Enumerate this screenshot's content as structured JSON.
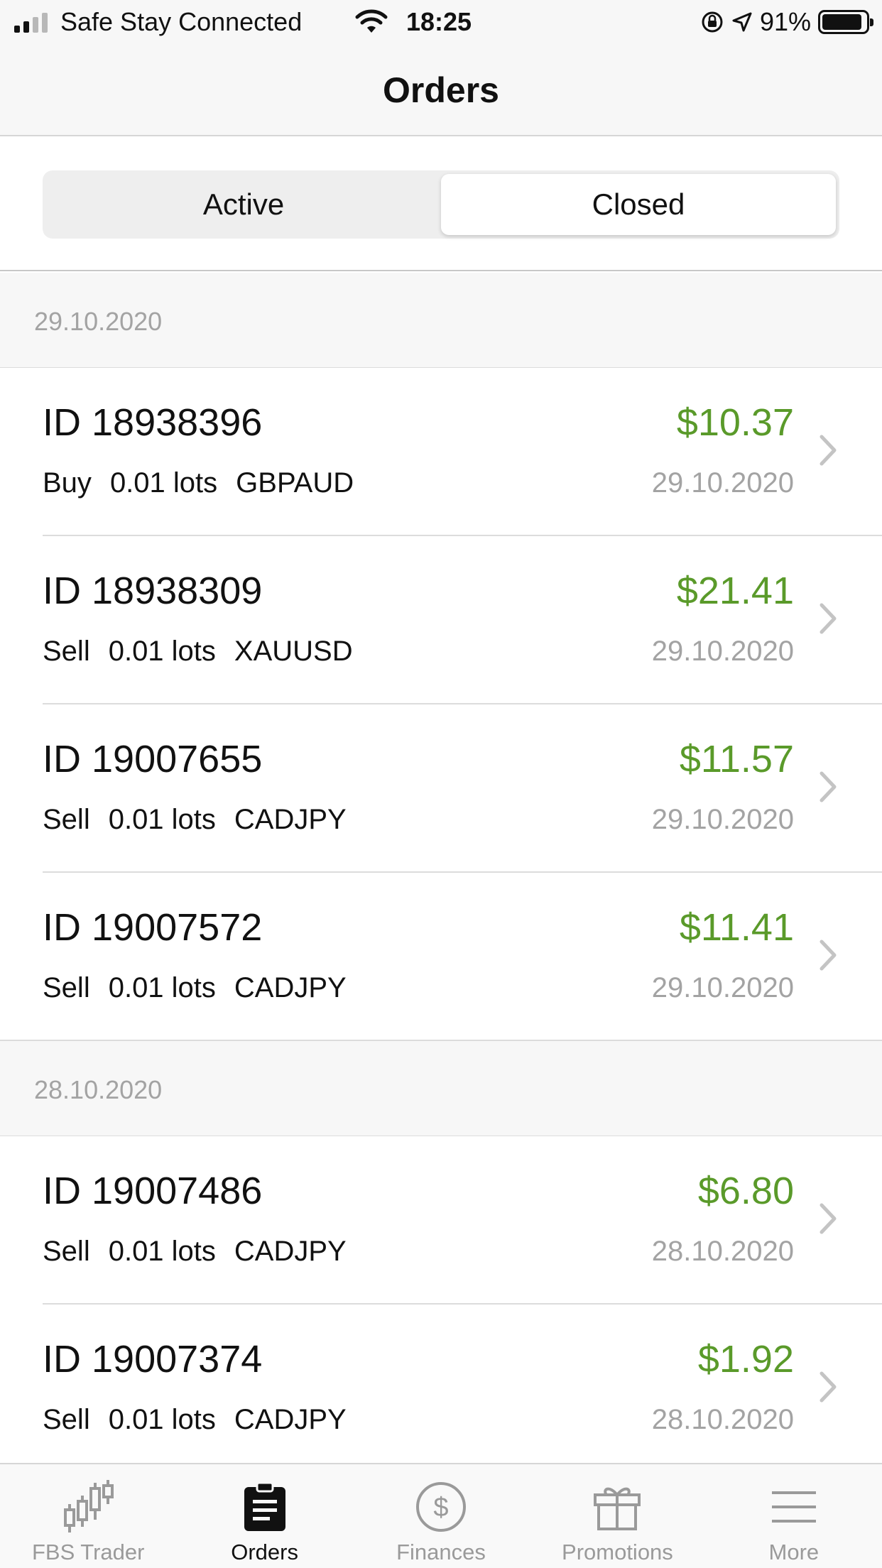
{
  "status_bar": {
    "carrier": "Safe Stay Connected",
    "time": "18:25",
    "battery": "91%",
    "battery_level": 0.91
  },
  "nav": {
    "title": "Orders"
  },
  "segment": {
    "active_label": "Active",
    "closed_label": "Closed",
    "selected": "Closed"
  },
  "sections": [
    {
      "date": "29.10.2020",
      "orders": [
        {
          "id": "ID 18938396",
          "side": "Buy",
          "lots": "0.01 lots",
          "symbol": "GBPAUD",
          "amount": "$10.37",
          "date": "29.10.2020"
        },
        {
          "id": "ID 18938309",
          "side": "Sell",
          "lots": "0.01 lots",
          "symbol": "XAUUSD",
          "amount": "$21.41",
          "date": "29.10.2020"
        },
        {
          "id": "ID 19007655",
          "side": "Sell",
          "lots": "0.01 lots",
          "symbol": "CADJPY",
          "amount": "$11.57",
          "date": "29.10.2020"
        },
        {
          "id": "ID 19007572",
          "side": "Sell",
          "lots": "0.01 lots",
          "symbol": "CADJPY",
          "amount": "$11.41",
          "date": "29.10.2020"
        }
      ]
    },
    {
      "date": "28.10.2020",
      "orders": [
        {
          "id": "ID 19007486",
          "side": "Sell",
          "lots": "0.01 lots",
          "symbol": "CADJPY",
          "amount": "$6.80",
          "date": "28.10.2020"
        },
        {
          "id": "ID 19007374",
          "side": "Sell",
          "lots": "0.01 lots",
          "symbol": "CADJPY",
          "amount": "$1.92",
          "date": "28.10.2020"
        }
      ]
    }
  ],
  "tabs": [
    {
      "label": "FBS Trader",
      "icon": "candlestick-chart-icon"
    },
    {
      "label": "Orders",
      "icon": "clipboard-icon"
    },
    {
      "label": "Finances",
      "icon": "dollar-circle-icon"
    },
    {
      "label": "Promotions",
      "icon": "gift-icon"
    },
    {
      "label": "More",
      "icon": "hamburger-menu-icon"
    }
  ],
  "colors": {
    "profit": "#5a9a2a",
    "muted": "#a3a3a3",
    "header_bg": "#f7f7f7"
  }
}
